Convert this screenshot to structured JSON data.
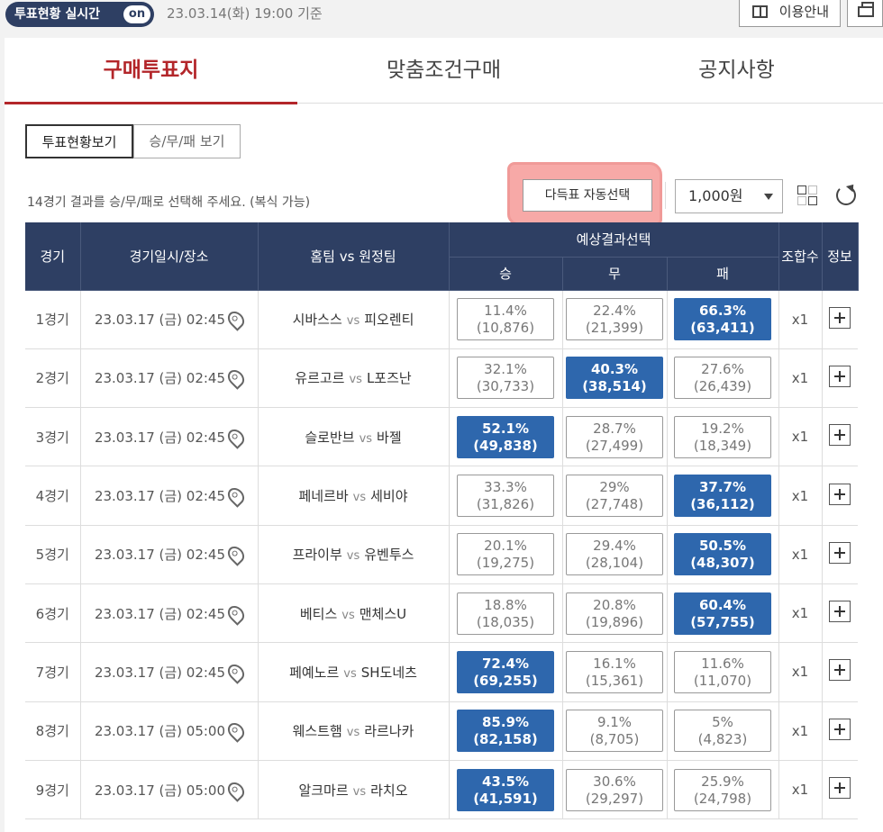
{
  "topbar": {
    "vote_status": "투표현황 실시간",
    "on_label": "on",
    "date": "23.03.14(화) 19:00 기준",
    "guide_label": "이용안내"
  },
  "tabs": [
    "구매투표지",
    "맞춤조건구매",
    "공지사항"
  ],
  "view_toggle": {
    "vote_view": "투표현황보기",
    "wdl_view": "승/무/패 보기"
  },
  "hint": "14경기 결과를 승/무/패로 선택해 주세요. (복식 가능)",
  "multi_vote_button": "다득표 자동선택",
  "amount": "1,000원",
  "colors": {
    "navy": "#2e3f63",
    "selected": "#2e67ad",
    "accent_red": "#b3262a",
    "highlight": "#f48c8a"
  },
  "table": {
    "headers": {
      "game": "경기",
      "datetime": "경기일시/장소",
      "teams": "홈팀 vs 원정팀",
      "prediction": "예상결과선택",
      "win": "승",
      "draw": "무",
      "loss": "패",
      "combo": "조합수",
      "info": "정보"
    },
    "vs": "vs",
    "rows": [
      {
        "game": "1경기",
        "date": "23.03.17 (금) 02:45",
        "home": "시바스스",
        "away": "피오렌티",
        "win_pct": "11.4%",
        "win_cnt": "(10,876)",
        "draw_pct": "22.4%",
        "draw_cnt": "(21,399)",
        "loss_pct": "66.3%",
        "loss_cnt": "(63,411)",
        "selected": "loss",
        "combo": "x1"
      },
      {
        "game": "2경기",
        "date": "23.03.17 (금) 02:45",
        "home": "유르고르",
        "away": "L포즈난",
        "win_pct": "32.1%",
        "win_cnt": "(30,733)",
        "draw_pct": "40.3%",
        "draw_cnt": "(38,514)",
        "loss_pct": "27.6%",
        "loss_cnt": "(26,439)",
        "selected": "draw",
        "combo": "x1"
      },
      {
        "game": "3경기",
        "date": "23.03.17 (금) 02:45",
        "home": "슬로반브",
        "away": "바젤",
        "win_pct": "52.1%",
        "win_cnt": "(49,838)",
        "draw_pct": "28.7%",
        "draw_cnt": "(27,499)",
        "loss_pct": "19.2%",
        "loss_cnt": "(18,349)",
        "selected": "win",
        "combo": "x1"
      },
      {
        "game": "4경기",
        "date": "23.03.17 (금) 02:45",
        "home": "페네르바",
        "away": "세비야",
        "win_pct": "33.3%",
        "win_cnt": "(31,826)",
        "draw_pct": "29%",
        "draw_cnt": "(27,748)",
        "loss_pct": "37.7%",
        "loss_cnt": "(36,112)",
        "selected": "loss",
        "combo": "x1"
      },
      {
        "game": "5경기",
        "date": "23.03.17 (금) 02:45",
        "home": "프라이부",
        "away": "유벤투스",
        "win_pct": "20.1%",
        "win_cnt": "(19,275)",
        "draw_pct": "29.4%",
        "draw_cnt": "(28,104)",
        "loss_pct": "50.5%",
        "loss_cnt": "(48,307)",
        "selected": "loss",
        "combo": "x1"
      },
      {
        "game": "6경기",
        "date": "23.03.17 (금) 02:45",
        "home": "베티스",
        "away": "맨체스U",
        "win_pct": "18.8%",
        "win_cnt": "(18,035)",
        "draw_pct": "20.8%",
        "draw_cnt": "(19,896)",
        "loss_pct": "60.4%",
        "loss_cnt": "(57,755)",
        "selected": "loss",
        "combo": "x1"
      },
      {
        "game": "7경기",
        "date": "23.03.17 (금) 02:45",
        "home": "페예노르",
        "away": "SH도네츠",
        "win_pct": "72.4%",
        "win_cnt": "(69,255)",
        "draw_pct": "16.1%",
        "draw_cnt": "(15,361)",
        "loss_pct": "11.6%",
        "loss_cnt": "(11,070)",
        "selected": "win",
        "combo": "x1"
      },
      {
        "game": "8경기",
        "date": "23.03.17 (금) 05:00",
        "home": "웨스트햄",
        "away": "라르나카",
        "win_pct": "85.9%",
        "win_cnt": "(82,158)",
        "draw_pct": "9.1%",
        "draw_cnt": "(8,705)",
        "loss_pct": "5%",
        "loss_cnt": "(4,823)",
        "selected": "win",
        "combo": "x1"
      },
      {
        "game": "9경기",
        "date": "23.03.17 (금) 05:00",
        "home": "알크마르",
        "away": "라치오",
        "win_pct": "43.5%",
        "win_cnt": "(41,591)",
        "draw_pct": "30.6%",
        "draw_cnt": "(29,297)",
        "loss_pct": "25.9%",
        "loss_cnt": "(24,798)",
        "selected": "win",
        "combo": "x1"
      }
    ]
  }
}
